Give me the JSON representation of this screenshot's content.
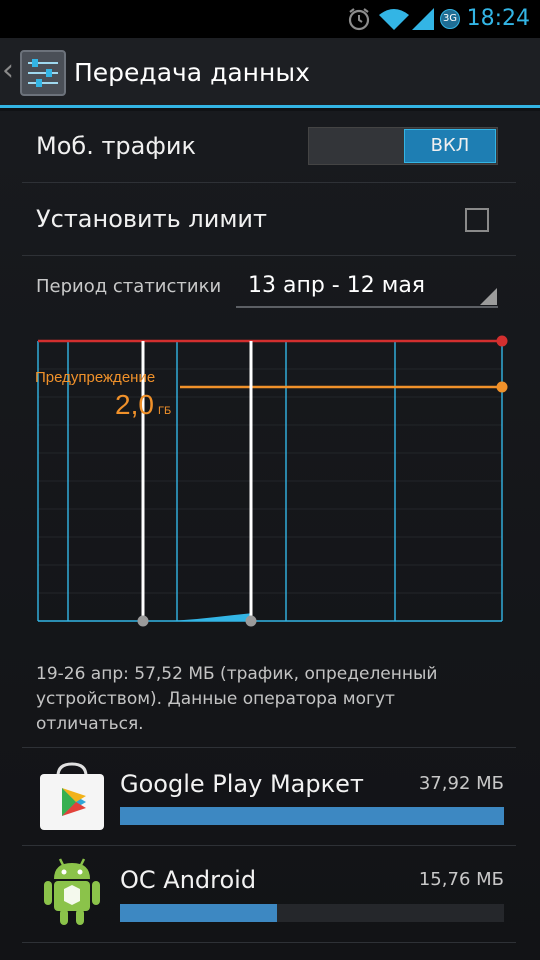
{
  "status_bar": {
    "time": "18:24",
    "network_badge": "3G",
    "accent": "#33b5e5",
    "icons": [
      "alarm-icon",
      "wifi-icon",
      "signal-icon",
      "network-badge-icon"
    ]
  },
  "action_bar": {
    "title": "Передача данных",
    "back_icon": "chevron-left-icon",
    "settings_icon": "sliders-icon"
  },
  "mobile_data": {
    "label": "Моб. трафик",
    "toggle_label": "ВКЛ",
    "enabled": true
  },
  "set_limit": {
    "label": "Установить лимит",
    "checked": false
  },
  "period": {
    "label": "Период статистики",
    "value": "13 апр - 12 мая"
  },
  "chart_data": {
    "type": "area",
    "warning_label": "Предупреждение",
    "warning_value": "2,0",
    "warning_unit": "ГБ",
    "colors": {
      "limit_line": "#d32f2f",
      "warning_line": "#f0912a",
      "usage_area": "#33b5e5",
      "grid": "#33b5e5"
    },
    "usage_series": [
      0.0,
      0.002,
      0.005,
      0.015,
      0.03,
      0.045,
      0.06
    ]
  },
  "info_text": "19-26 апр: 57,52 МБ (трафик, определенный устройством). Данные оператора могут отличаться.",
  "apps": [
    {
      "name": "Google Play Маркет",
      "size": "37,92 МБ",
      "fraction": 1.0,
      "icon": "google-play-icon"
    },
    {
      "name": "ОС Android",
      "size": "15,76 МБ",
      "fraction": 0.41,
      "icon": "android-icon"
    }
  ]
}
